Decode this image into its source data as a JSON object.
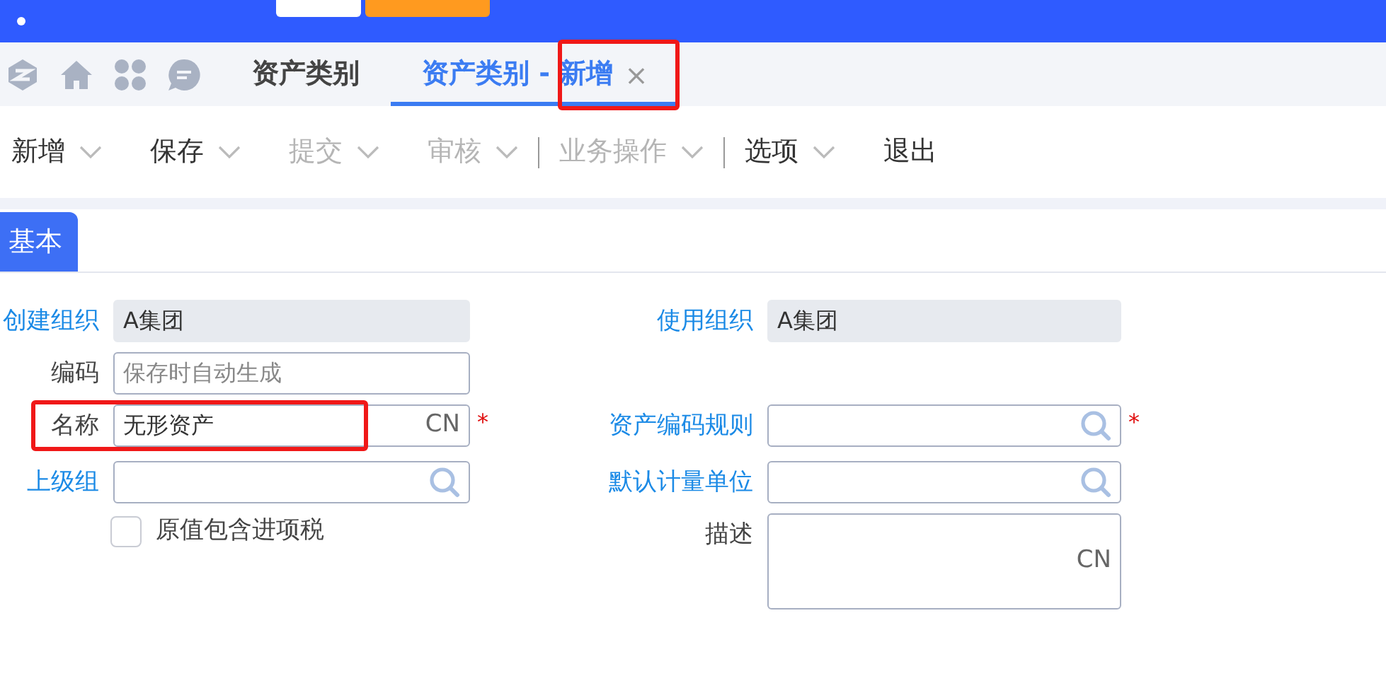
{
  "top_bar": {
    "kind": "cut"
  },
  "tabs": [
    {
      "label": "资产类别",
      "selected": false,
      "closable": false,
      "annotated": false
    },
    {
      "label": "资产类别 - 新增",
      "selected": true,
      "closable": true,
      "annotated": true,
      "close": "×"
    }
  ],
  "toolbar": [
    {
      "kind": "button",
      "label": "新增",
      "disabled": false,
      "dropdown": true
    },
    {
      "kind": "button",
      "label": "保存",
      "disabled": false,
      "dropdown": true
    },
    {
      "kind": "button",
      "label": "提交",
      "disabled": true,
      "dropdown": true
    },
    {
      "kind": "button",
      "label": "审核",
      "disabled": true,
      "dropdown": true
    },
    {
      "kind": "separator"
    },
    {
      "kind": "button",
      "label": "业务操作",
      "disabled": true,
      "dropdown": true
    },
    {
      "kind": "separator"
    },
    {
      "kind": "button",
      "label": "选项",
      "disabled": false,
      "dropdown": true
    },
    {
      "kind": "button",
      "label": "退出",
      "disabled": false,
      "dropdown": false
    }
  ],
  "form_tabs": [
    {
      "label": "基本",
      "selected": true
    }
  ],
  "form_rows": [
    {
      "left": {
        "kind": "readonly",
        "label": "创建组织",
        "linked": true,
        "value": "A集团"
      },
      "right": {
        "kind": "readonly",
        "label": "使用组织",
        "linked": true,
        "value": "A集团"
      }
    },
    {
      "left": {
        "kind": "text",
        "label": "编码",
        "linked": false,
        "placeholder": "保存时自动生成"
      }
    },
    {
      "left": {
        "kind": "text",
        "label": "名称",
        "linked": false,
        "value": "无形资产",
        "suffix": "CN",
        "required": "*",
        "annotated": true
      },
      "right": {
        "kind": "lookup",
        "label": "资产编码规则",
        "linked": true,
        "required": "*"
      }
    },
    {
      "left": {
        "kind": "lookup",
        "label": "上级组",
        "linked": true
      },
      "right": {
        "kind": "lookup",
        "label": "默认计量单位",
        "linked": true
      }
    },
    {
      "left": {
        "kind": "checkbox",
        "label": "原值包含进项税",
        "checked": false
      },
      "right": {
        "kind": "textarea",
        "label": "描述",
        "linked": false,
        "suffix": "CN"
      }
    }
  ]
}
